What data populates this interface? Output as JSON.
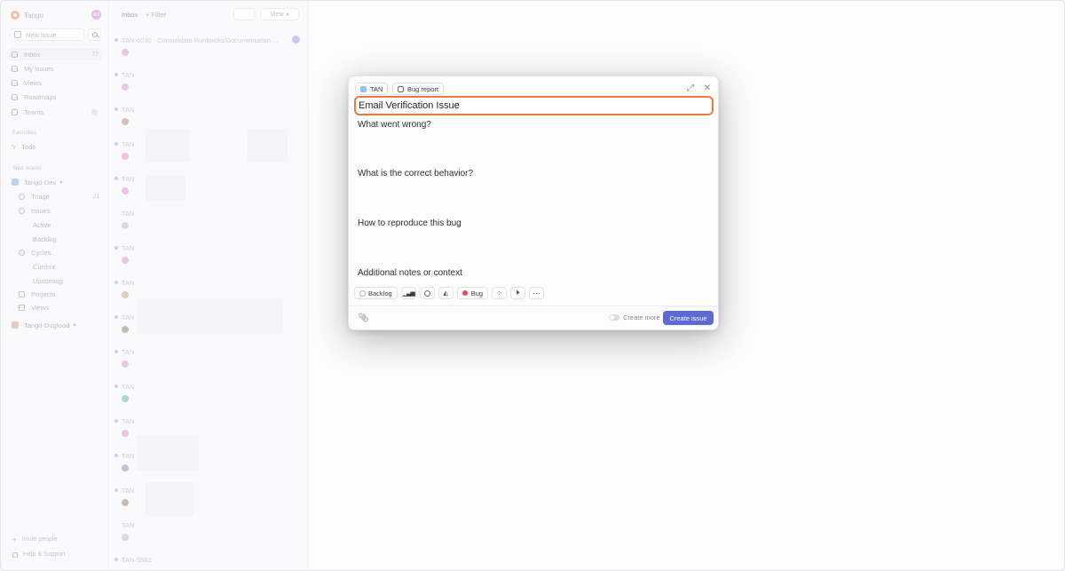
{
  "workspace": {
    "name": "Tango",
    "avatar_initials": "AM"
  },
  "sidebar": {
    "new_issue_label": "New issue",
    "items": [
      {
        "label": "Inbox",
        "count": "77"
      },
      {
        "label": "My issues"
      },
      {
        "label": "Views"
      },
      {
        "label": "Roadmaps"
      },
      {
        "label": "Teams"
      }
    ],
    "favorites_label": "Favorites",
    "favorites": [
      {
        "label": "Todo"
      }
    ],
    "your_teams_label": "Your teams",
    "team1": {
      "name": "Tango-Dev",
      "items": [
        {
          "label": "Triage",
          "count": "21"
        },
        {
          "label": "Issues"
        },
        {
          "label": "Active"
        },
        {
          "label": "Backlog"
        },
        {
          "label": "Cycles"
        },
        {
          "label": "Current"
        },
        {
          "label": "Upcoming"
        },
        {
          "label": "Projects"
        },
        {
          "label": "Views"
        }
      ]
    },
    "team2": {
      "name": "Tango-Dogfood"
    },
    "invite_label": "Invite people",
    "help_label": "Help & Support"
  },
  "list": {
    "title": "Inbox",
    "filter_label": "+ Filter",
    "view_label": "View",
    "first_key": "TAN-6030",
    "first_title": "Consolidate Runbooks/Documentation ...",
    "row_key": "TAN",
    "last_key": "TAN-5583"
  },
  "modal": {
    "team_chip": "TAN",
    "template_chip": "Bug report",
    "title_value": "Email Verification Issue",
    "sections": [
      "What went wrong?",
      "What is the correct behavior?",
      "How to reproduce this bug",
      "Additional notes or context"
    ],
    "status_label": "Backlog",
    "label_value": "Bug",
    "create_more_label": "Create more",
    "create_button_label": "Create issue"
  },
  "colors": {
    "accent": "#5e6ad2",
    "focus_ring": "#e87a3e",
    "bug_label": "#e5484d"
  }
}
